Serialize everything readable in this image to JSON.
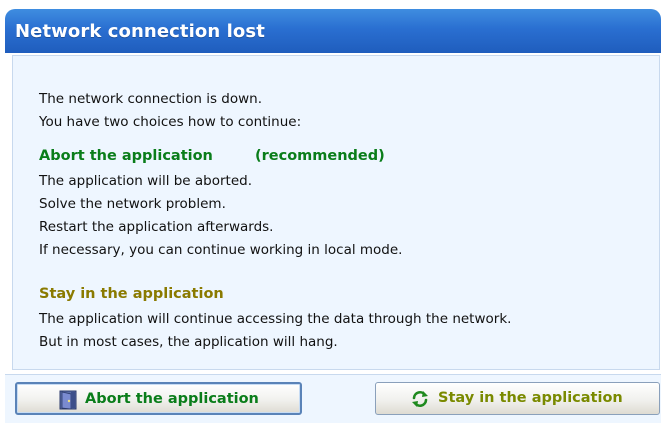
{
  "window": {
    "title": "Network connection lost"
  },
  "message": {
    "intro_line1": "The network connection is down.",
    "intro_line2": "You have two choices how to continue:",
    "abort_heading": "Abort the application",
    "abort_recommended": "(recommended)",
    "abort_lines": [
      "The application will be aborted.",
      "Solve the network problem.",
      "Restart the application afterwards.",
      "If necessary, you can continue working in local mode."
    ],
    "stay_heading": "Stay in the application",
    "stay_lines": [
      "The application will continue accessing the data through the network.",
      "But in most cases, the application will hang."
    ]
  },
  "buttons": {
    "abort_label": "Abort the application",
    "abort_icon": "exit-door-icon",
    "stay_label": "Stay in the application",
    "stay_icon": "refresh-arrows-icon"
  },
  "colors": {
    "title_bar": "#2a6fd1",
    "abort_text": "#0a7d1a",
    "stay_text": "#8a7a00",
    "panel_bg": "#eef6ff"
  }
}
